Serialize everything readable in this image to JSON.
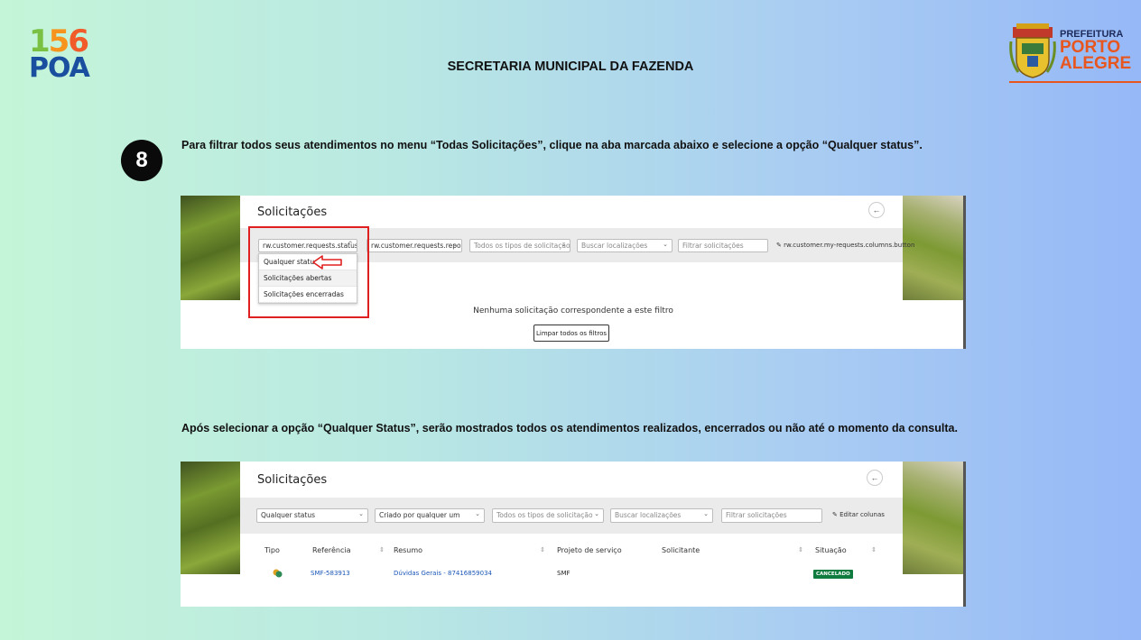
{
  "brand": {
    "logo_line1_a": "1",
    "logo_line1_b": "5",
    "logo_line1_c": "6",
    "logo_line2": "POA",
    "prefeitura_line1": "PREFEITURA",
    "prefeitura_line2": "PORTO",
    "prefeitura_line3": "ALEGRE"
  },
  "header_title": "SECRETARIA MUNICIPAL DA FAZENDA",
  "step": {
    "number": "8",
    "instruction": "Para filtrar todos seus atendimentos no menu “Todas Solicitações”, clique na aba marcada abaixo e selecione a opção “Qualquer status”."
  },
  "screenshot1": {
    "title": "Solicitações",
    "back_icon": "←",
    "filters": {
      "status": "rw.customer.requests.status.c",
      "status_chev": "^",
      "report": "rw.customer.requests.repo...",
      "types": "Todos os tipos de solicitação",
      "locations": "Buscar localizações",
      "search_placeholder": "Filtrar solicitações",
      "columns_button": "rw.customer.my-requests.columns.button"
    },
    "dropdown_options": [
      "Qualquer status",
      "Solicitações abertas",
      "Solicitações encerradas"
    ],
    "empty_message": "Nenhuma solicitação correspondente a este filtro",
    "clear_button": "Limpar todos os filtros"
  },
  "explanation": "Após selecionar a opção “Qualquer Status”, serão mostrados todos os atendimentos realizados, encerrados ou não até o momento da consulta.",
  "screenshot2": {
    "title": "Solicitações",
    "back_icon": "←",
    "filters": {
      "status": "Qualquer status",
      "creator": "Criado por qualquer um",
      "types": "Todos os tipos de solicitação",
      "locations": "Buscar localizações",
      "search_placeholder": "Filtrar solicitações",
      "edit_columns": "Editar colunas"
    },
    "columns": [
      "Tipo",
      "Referência",
      "Resumo",
      "Projeto de serviço",
      "Solicitante",
      "Situação"
    ],
    "rows": [
      {
        "reference": "SMF-583913",
        "summary": "Dúvidas Gerais - 87416859034",
        "project": "SMF",
        "requester": "",
        "status": "CANCELADO"
      }
    ]
  },
  "colors": {
    "accent_orange": "#e8561f",
    "highlight_red": "#e02020",
    "link_blue": "#1a56b8",
    "badge_green": "#0f7b3e"
  }
}
